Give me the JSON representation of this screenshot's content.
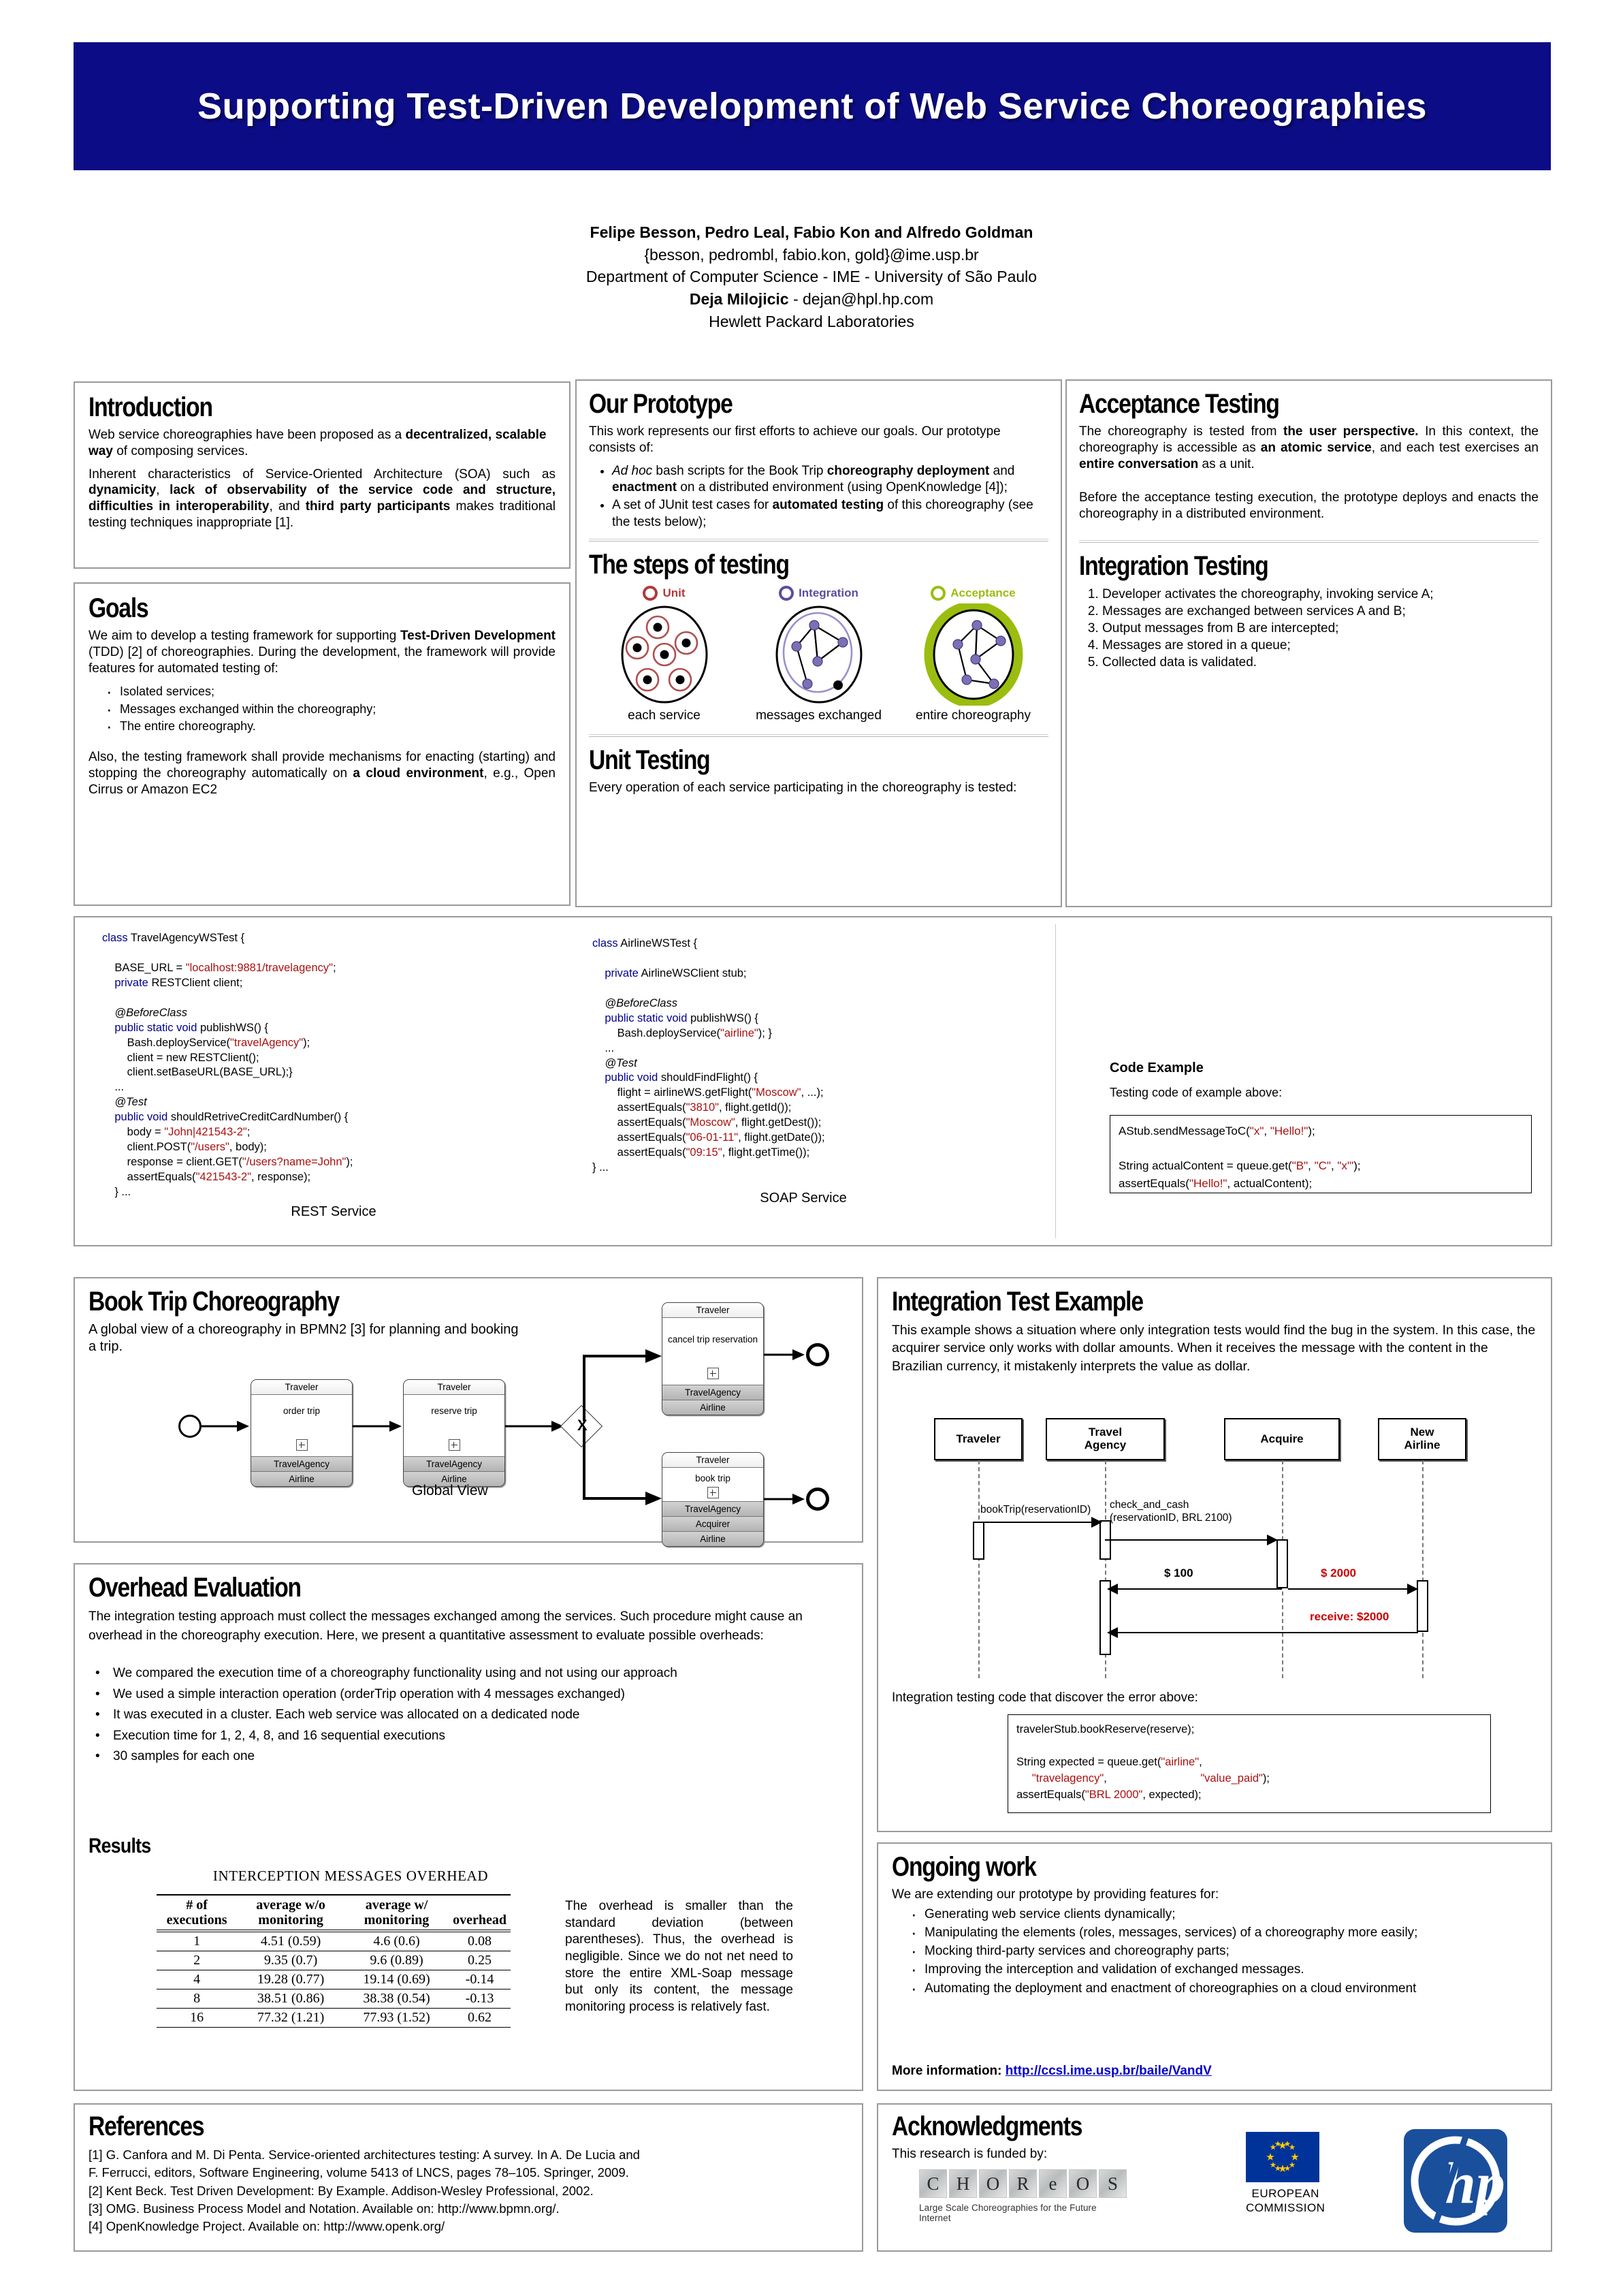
{
  "title": "Supporting Test-Driven Development of Web Service Choreographies",
  "authors": {
    "names": "Felipe Besson, Pedro Leal, Fabio Kon and Alfredo Goldman",
    "emails": "{besson, pedrombl, fabio.kon, gold}@ime.usp.br",
    "department": "Department of Computer Science - IME - University of São Paulo",
    "second_author_name": "Deja Milojicic",
    "second_author_email": " - dejan@hpl.hp.com",
    "second_affiliation": "Hewlett Packard Laboratories"
  },
  "introduction": {
    "heading": "Introduction",
    "p1_a": "Web service choreographies have been proposed as a ",
    "p1_b": "decentralized, scalable way",
    "p1_c": " of composing services.",
    "p2_a": "Inherent characteristics of Service-Oriented Architecture (SOA) such as ",
    "p2_b": "dynamicity",
    "p2_c": ", ",
    "p2_d": "lack of observability of the service code and structure, difficulties in interoperability",
    "p2_e": ", and ",
    "p2_f": "third party participants",
    "p2_g": "  makes traditional testing techniques inappropriate [1]."
  },
  "goals": {
    "heading": "Goals",
    "p1_a": "We aim to develop a testing framework for supporting ",
    "p1_b": "Test-Driven Development",
    "p1_c": " (TDD) [2] of  choreographies. During the development, the framework will provide features for automated testing of:",
    "bullets": [
      "Isolated services;",
      "Messages exchanged within the choreography;",
      "The entire choreography."
    ],
    "p2_a": "Also, the testing framework shall provide mechanisms for enacting (starting) and stopping the choreography automatically on ",
    "p2_b": "a cloud environment",
    "p2_c": ", e.g., Open Cirrus or Amazon EC2"
  },
  "prototype": {
    "heading": "Our Prototype",
    "p1": "This work represents our first efforts to achieve our goals. Our prototype consists of:",
    "b1_a": "Ad hoc",
    "b1_b": " bash scripts for the Book Trip ",
    "b1_c": "choreography deployment",
    "b1_d": " and ",
    "b1_e": "enactment",
    "b1_f": " on a distributed environment (using OpenKnowledge [4]);",
    "b2_a": "A set of JUnit test cases for ",
    "b2_b": "automated testing",
    "b2_c": " of this choreography (see the tests below);"
  },
  "steps": {
    "heading": "The steps of testing",
    "items": [
      {
        "label": "Unit",
        "caption": "each service",
        "color": "#b03a3a"
      },
      {
        "label": "Integration",
        "caption": "messages exchanged",
        "color": "#5b4d9e"
      },
      {
        "label": "Acceptance",
        "caption": "entire choreography",
        "color": "#9bbd0f"
      }
    ]
  },
  "unit_testing": {
    "heading": "Unit Testing",
    "p1": "Every operation of each service participating in the choreography is tested:"
  },
  "acceptance": {
    "heading": "Acceptance Testing",
    "p1_a": "The choreography is tested from ",
    "p1_b": "the user perspective.",
    "p1_c": " In this context, the choreography is accessible as ",
    "p1_d": "an atomic service",
    "p1_e": ", and each test exercises an ",
    "p1_f": "entire conversation",
    "p1_g": " as a unit.",
    "p2": "Before the acceptance testing execution, the prototype deploys and enacts the choreography in a distributed environment."
  },
  "integration": {
    "heading": "Integration Testing",
    "steps": [
      "Developer activates the choreography, invoking service A;",
      "Messages are exchanged between services A and B;",
      "Output messages from B are intercepted;",
      "Messages are stored in a queue;",
      "Collected data is validated."
    ]
  },
  "code_rest": {
    "caption": "REST Service",
    "lines": [
      [
        {
          "t": "class ",
          "c": "kw"
        },
        {
          "t": "TravelAgencyWSTest {",
          "c": ""
        }
      ],
      [
        {
          "t": "",
          "c": ""
        }
      ],
      [
        {
          "t": "    BASE_URL = ",
          "c": ""
        },
        {
          "t": "\"localhost:9881/travelagency\"",
          "c": "str"
        },
        {
          "t": ";",
          "c": ""
        }
      ],
      [
        {
          "t": "    private ",
          "c": "kw"
        },
        {
          "t": "RESTClient client;",
          "c": ""
        }
      ],
      [
        {
          "t": "",
          "c": ""
        }
      ],
      [
        {
          "t": "    @BeforeClass",
          "c": "ann"
        }
      ],
      [
        {
          "t": "    public static void ",
          "c": "kw"
        },
        {
          "t": "publishWS() {",
          "c": ""
        }
      ],
      [
        {
          "t": "        Bash.deployService(",
          "c": ""
        },
        {
          "t": "\"travelAgency\"",
          "c": "str"
        },
        {
          "t": ");",
          "c": ""
        }
      ],
      [
        {
          "t": "        client = new RESTClient();",
          "c": ""
        }
      ],
      [
        {
          "t": "        client.setBaseURL(BASE_URL);}",
          "c": ""
        }
      ],
      [
        {
          "t": "    ...",
          "c": ""
        }
      ],
      [
        {
          "t": "    @Test",
          "c": "ann"
        }
      ],
      [
        {
          "t": "    public void ",
          "c": "kw"
        },
        {
          "t": "shouldRetriveCreditCardNumber() {",
          "c": ""
        }
      ],
      [
        {
          "t": "        body = ",
          "c": ""
        },
        {
          "t": "\"John|421543-2\"",
          "c": "str"
        },
        {
          "t": ";",
          "c": ""
        }
      ],
      [
        {
          "t": "        client.POST(",
          "c": ""
        },
        {
          "t": "\"/users\"",
          "c": "str"
        },
        {
          "t": ", body);",
          "c": ""
        }
      ],
      [
        {
          "t": "        response = client.GET(",
          "c": ""
        },
        {
          "t": "\"/users?name=John\"",
          "c": "str"
        },
        {
          "t": ");",
          "c": ""
        }
      ],
      [
        {
          "t": "        assertEquals(",
          "c": ""
        },
        {
          "t": "\"421543-2\"",
          "c": "str"
        },
        {
          "t": ", response);",
          "c": ""
        }
      ],
      [
        {
          "t": "    } ...",
          "c": ""
        }
      ]
    ]
  },
  "code_soap": {
    "caption": "SOAP Service",
    "lines": [
      [
        {
          "t": "class ",
          "c": "kw"
        },
        {
          "t": "AirlineWSTest {",
          "c": ""
        }
      ],
      [
        {
          "t": "",
          "c": ""
        }
      ],
      [
        {
          "t": "    private ",
          "c": "kw"
        },
        {
          "t": "AirlineWSClient stub;",
          "c": ""
        }
      ],
      [
        {
          "t": "",
          "c": ""
        }
      ],
      [
        {
          "t": "    @BeforeClass",
          "c": "ann"
        }
      ],
      [
        {
          "t": "    public static void ",
          "c": "kw"
        },
        {
          "t": "publishWS() {",
          "c": ""
        }
      ],
      [
        {
          "t": "        Bash.deployService(",
          "c": ""
        },
        {
          "t": "\"airline\"",
          "c": "str"
        },
        {
          "t": "); }",
          "c": ""
        }
      ],
      [
        {
          "t": "    ...",
          "c": ""
        }
      ],
      [
        {
          "t": "    @Test",
          "c": "ann"
        }
      ],
      [
        {
          "t": "    public void ",
          "c": "kw"
        },
        {
          "t": "shouldFindFlight() {",
          "c": ""
        }
      ],
      [
        {
          "t": "        flight = airlineWS.getFlight(",
          "c": ""
        },
        {
          "t": "\"Moscow\"",
          "c": "str"
        },
        {
          "t": ", ...);",
          "c": ""
        }
      ],
      [
        {
          "t": "        assertEquals(",
          "c": ""
        },
        {
          "t": "\"3810\"",
          "c": "str"
        },
        {
          "t": ", flight.getId());",
          "c": ""
        }
      ],
      [
        {
          "t": "        assertEquals(",
          "c": ""
        },
        {
          "t": "\"Moscow\"",
          "c": "str"
        },
        {
          "t": ", flight.getDest());",
          "c": ""
        }
      ],
      [
        {
          "t": "        assertEquals(",
          "c": ""
        },
        {
          "t": "\"06-01-11\"",
          "c": "str"
        },
        {
          "t": ", flight.getDate());",
          "c": ""
        }
      ],
      [
        {
          "t": "        assertEquals(",
          "c": ""
        },
        {
          "t": "\"09:15\"",
          "c": "str"
        },
        {
          "t": ", flight.getTime());",
          "c": ""
        }
      ],
      [
        {
          "t": "} ...",
          "c": ""
        }
      ]
    ]
  },
  "code_example": {
    "heading": "Code Example",
    "subtitle": "Testing code of example above:",
    "lines": [
      [
        {
          "t": "AStub.sendMessageToC(",
          "c": ""
        },
        {
          "t": "\"x\"",
          "c": "str"
        },
        {
          "t": ", ",
          "c": ""
        },
        {
          "t": "\"Hello!\"",
          "c": "str"
        },
        {
          "t": ");",
          "c": ""
        }
      ],
      [
        {
          "t": "",
          "c": ""
        }
      ],
      [
        {
          "t": "String actualContent = queue.get(",
          "c": ""
        },
        {
          "t": "\"B\"",
          "c": "str"
        },
        {
          "t": ", ",
          "c": ""
        },
        {
          "t": "\"C\"",
          "c": "str"
        },
        {
          "t": ", ",
          "c": ""
        },
        {
          "t": "\"x'\"",
          "c": "str"
        },
        {
          "t": ");",
          "c": ""
        }
      ],
      [
        {
          "t": "assertEquals(",
          "c": ""
        },
        {
          "t": "\"Hello!\"",
          "c": "str"
        },
        {
          "t": ", actualContent);",
          "c": ""
        }
      ]
    ]
  },
  "booktrip": {
    "heading": "Book Trip Choreography",
    "p1": "A global view of a choreography in BPMN2 [3]  for planning and booking a trip.",
    "global_view_label": "Global View",
    "tasks": [
      {
        "top": "Traveler",
        "mid": "order trip",
        "bands": [
          "TravelAgency",
          "Airline"
        ]
      },
      {
        "top": "Traveler",
        "mid": "reserve trip",
        "bands": [
          "TravelAgency",
          "Airline"
        ]
      },
      {
        "top": "Traveler",
        "mid": "cancel trip reservation",
        "bands": [
          "TravelAgency",
          "Airline"
        ]
      },
      {
        "top": "Traveler",
        "mid": "book trip",
        "bands": [
          "TravelAgency",
          "Acquirer",
          "Airline"
        ]
      }
    ],
    "gateway": "X"
  },
  "integration_example": {
    "heading": "Integration Test Example",
    "p1": "This example shows a situation where only integration tests would find the bug in the system. In this case, the acquirer service only works with dollar amounts. When it receives the message with the content in the Brazilian currency, it mistakenly interprets the value as dollar.",
    "lifelines": [
      "Traveler",
      "Travel\nAgency",
      "Acquire",
      "New\nAirline"
    ],
    "msg1": "bookTrip(reservationID)",
    "msg2_line1": "check_and_cash",
    "msg2_line2": "(reservationID, BRL 2100)",
    "msg3": "$ 100",
    "msg4": "$ 2000",
    "msg5": "receive: $2000",
    "code_caption": "Integration testing code that discover the error above:",
    "code_lines": [
      [
        {
          "t": "travelerStub.bookReserve(reserve);",
          "c": ""
        }
      ],
      [
        {
          "t": "",
          "c": ""
        }
      ],
      [
        {
          "t": "String expected = queue.get(",
          "c": ""
        },
        {
          "t": "\"airline\"",
          "c": "str"
        },
        {
          "t": ",",
          "c": ""
        }
      ],
      [
        {
          "t": "     ",
          "c": ""
        },
        {
          "t": "\"travelagency\"",
          "c": "str"
        },
        {
          "t": ",                              ",
          "c": ""
        },
        {
          "t": "\"value_paid\"",
          "c": "str"
        },
        {
          "t": ");",
          "c": ""
        }
      ],
      [
        {
          "t": "assertEquals(",
          "c": ""
        },
        {
          "t": "\"BRL 2000\"",
          "c": "str"
        },
        {
          "t": ", expected);",
          "c": ""
        }
      ]
    ]
  },
  "overhead": {
    "heading": "Overhead Evaluation",
    "p1": "The integration testing approach must collect the messages exchanged among the services. Such procedure might cause an overhead in the choreography execution. Here, we present a quantitative assessment to evaluate possible overheads:",
    "bullets": [
      "We compared the execution time of a choreography functionality using and not using our approach",
      "We used a simple interaction operation (orderTrip operation with 4 messages exchanged)",
      "It was executed in a cluster. Each web service was allocated on a dedicated node",
      "Execution time for 1, 2, 4, 8, and 16 sequential executions",
      "30 samples for each one"
    ],
    "results_heading": "Results",
    "table_title": "INTERCEPTION MESSAGES OVERHEAD",
    "side_text": "The overhead is smaller than the standard deviation (between parentheses). Thus, the overhead is negligible. Since we do not net need to store the entire XML-Soap message but only its content, the message monitoring process is relatively fast."
  },
  "chart_data": {
    "type": "table",
    "title": "INTERCEPTION MESSAGES OVERHEAD",
    "columns": [
      "# of executions",
      "average w/o monitoring",
      "average w/ monitoring",
      "overhead"
    ],
    "rows": [
      [
        "1",
        "4.51 (0.59)",
        "4.6 (0.6)",
        "0.08"
      ],
      [
        "2",
        "9.35 (0.7)",
        "9.6 (0.89)",
        "0.25"
      ],
      [
        "4",
        "19.28 (0.77)",
        "19.14 (0.69)",
        "-0.14"
      ],
      [
        "8",
        "38.51 (0.86)",
        "38.38 (0.54)",
        "-0.13"
      ],
      [
        "16",
        "77.32 (1.21)",
        "77.93 (1.52)",
        "0.62"
      ]
    ],
    "categories": [
      1,
      2,
      4,
      8,
      16
    ],
    "series": [
      {
        "name": "average w/o monitoring",
        "values": [
          4.51,
          9.35,
          19.28,
          38.51,
          77.32
        ],
        "stddev": [
          0.59,
          0.7,
          0.77,
          0.86,
          1.21
        ]
      },
      {
        "name": "average w/ monitoring",
        "values": [
          4.6,
          9.6,
          19.14,
          38.38,
          77.93
        ],
        "stddev": [
          0.6,
          0.89,
          0.69,
          0.54,
          1.52
        ]
      },
      {
        "name": "overhead",
        "values": [
          0.08,
          0.25,
          -0.14,
          -0.13,
          0.62
        ]
      }
    ]
  },
  "ongoing": {
    "heading": "Ongoing work",
    "p1": "We are extending our prototype by providing features for:",
    "bullets": [
      "Generating web service clients dynamically;",
      "Manipulating the elements (roles, messages, services) of a choreography more easily;",
      "Mocking third-party services and choreography parts;",
      "Improving the interception and validation of exchanged messages.",
      "Automating the deployment and enactment of choreographies on a cloud environment"
    ],
    "more_info_label": "More information: ",
    "more_info_url": "http://ccsl.ime.usp.br/baile/VandV"
  },
  "references": {
    "heading": "References",
    "items": [
      "[1] G. Canfora and M. Di Penta. Service-oriented architectures testing: A survey. In A. De Lucia and",
      "F. Ferrucci, editors, Software Engineering, volume 5413 of LNCS, pages 78–105. Springer, 2009.",
      "[2] Kent Beck. Test Driven Development: By Example. Addison-Wesley Professional,  2002.",
      "[3] OMG. Business Process Model and Notation. Available on: http://www.bpmn.org/.",
      "[4] OpenKnowledge Project. Available on: http://www.openk.org/"
    ]
  },
  "acknowledgments": {
    "heading": "Acknowledgments",
    "p1": "This research is funded by:",
    "choreos_letters": [
      "C",
      "H",
      "O",
      "R",
      "e",
      "O",
      "S"
    ],
    "choreos_tagline": "Large Scale Choreographies for the Future Internet",
    "eu_line1": "EUROPEAN",
    "eu_line2": "COMMISSION",
    "hp_label": "hp"
  }
}
